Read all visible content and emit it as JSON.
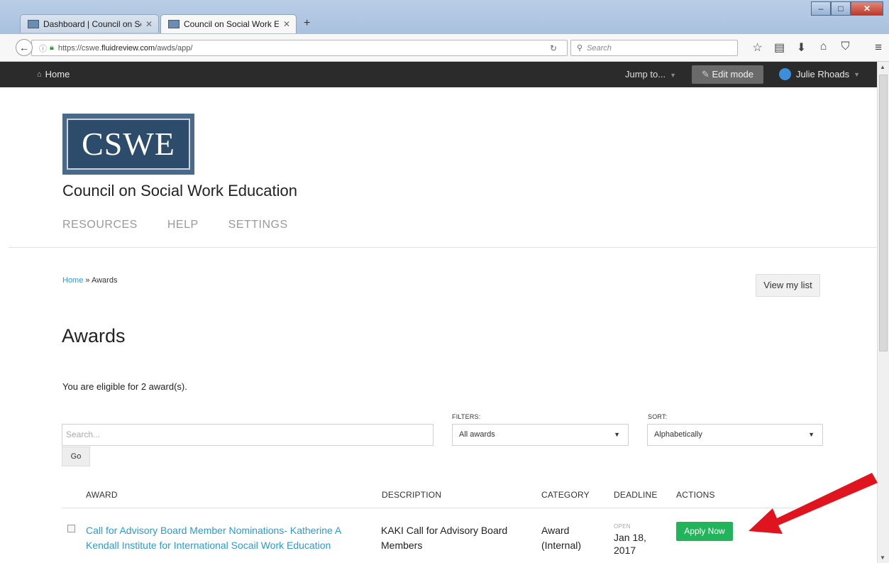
{
  "browser": {
    "tabs": [
      {
        "title": "Dashboard | Council on So...",
        "active": false
      },
      {
        "title": "Council on Social Work Ed...",
        "active": true
      }
    ],
    "new_tab": "+",
    "url_prefix": "https://cswe.",
    "url_host": "fluidreview.com",
    "url_path": "/awds/app/",
    "search_placeholder": "Search"
  },
  "appbar": {
    "home_label": "Home",
    "jump_to": "Jump to...",
    "edit_mode": "Edit mode",
    "user_name": "Julie Rhoads"
  },
  "site": {
    "logo_text": "CSWE",
    "org_name": "Council on Social Work Education",
    "nav": [
      "RESOURCES",
      "HELP",
      "SETTINGS"
    ]
  },
  "breadcrumb": {
    "home": "Home",
    "separator": " » ",
    "current": "Awards"
  },
  "view_my_list": "View my list",
  "page_title": "Awards",
  "eligibility_text": "You are eligible for 2 award(s).",
  "filters": {
    "search_placeholder": "Search...",
    "go_label": "Go",
    "filters_label": "FILTERS:",
    "filter_value": "All awards",
    "sort_label": "SORT:",
    "sort_value": "Alphabetically"
  },
  "table": {
    "headers": [
      "AWARD",
      "DESCRIPTION",
      "CATEGORY",
      "DEADLINE",
      "ACTIONS"
    ],
    "rows": [
      {
        "award": "Call for Advisory Board Member Nominations- Katherine A Kendall Institute for International Socail Work Education",
        "description": "KAKI Call for Advisory Board Members",
        "category": "Award (Internal)",
        "deadline_status": "OPEN",
        "deadline": "Jan 18, 2017",
        "action": "Apply Now"
      }
    ]
  },
  "colors": {
    "appbar_bg": "#2b2b2b",
    "link_blue": "#2b9ad6",
    "apply_green": "#21b45a",
    "annotation_arrow": "#e0141e"
  }
}
